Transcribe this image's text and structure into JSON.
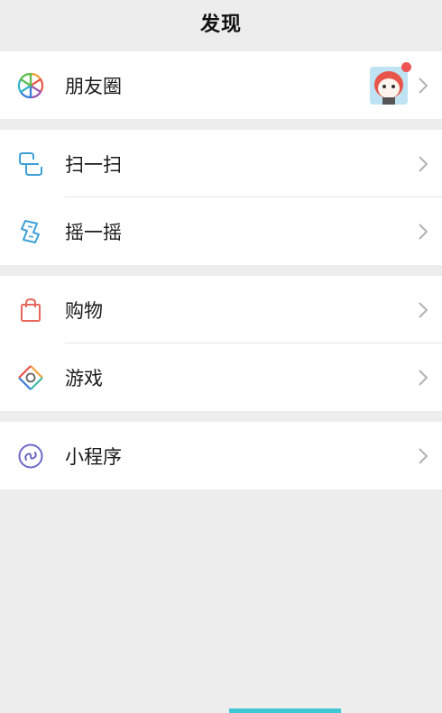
{
  "header": {
    "title": "发现"
  },
  "groups": [
    {
      "items": [
        {
          "label": "朋友圈",
          "icon": "moments-icon",
          "has_avatar": true,
          "has_badge": true
        }
      ]
    },
    {
      "items": [
        {
          "label": "扫一扫",
          "icon": "scan-icon"
        },
        {
          "label": "摇一摇",
          "icon": "shake-icon"
        }
      ]
    },
    {
      "items": [
        {
          "label": "购物",
          "icon": "shopping-bag-icon"
        },
        {
          "label": "游戏",
          "icon": "games-icon"
        }
      ]
    },
    {
      "items": [
        {
          "label": "小程序",
          "icon": "mini-program-icon"
        }
      ]
    }
  ],
  "colors": {
    "background": "#ededed",
    "cell": "#ffffff",
    "badge": "#f05454",
    "chevron": "#b2b2b2",
    "scan_icon": "#3d9fd8",
    "shake_icon": "#3d9fd8",
    "shopping_icon": "#e8685c",
    "mini_program_icon": "#6d68c7"
  }
}
